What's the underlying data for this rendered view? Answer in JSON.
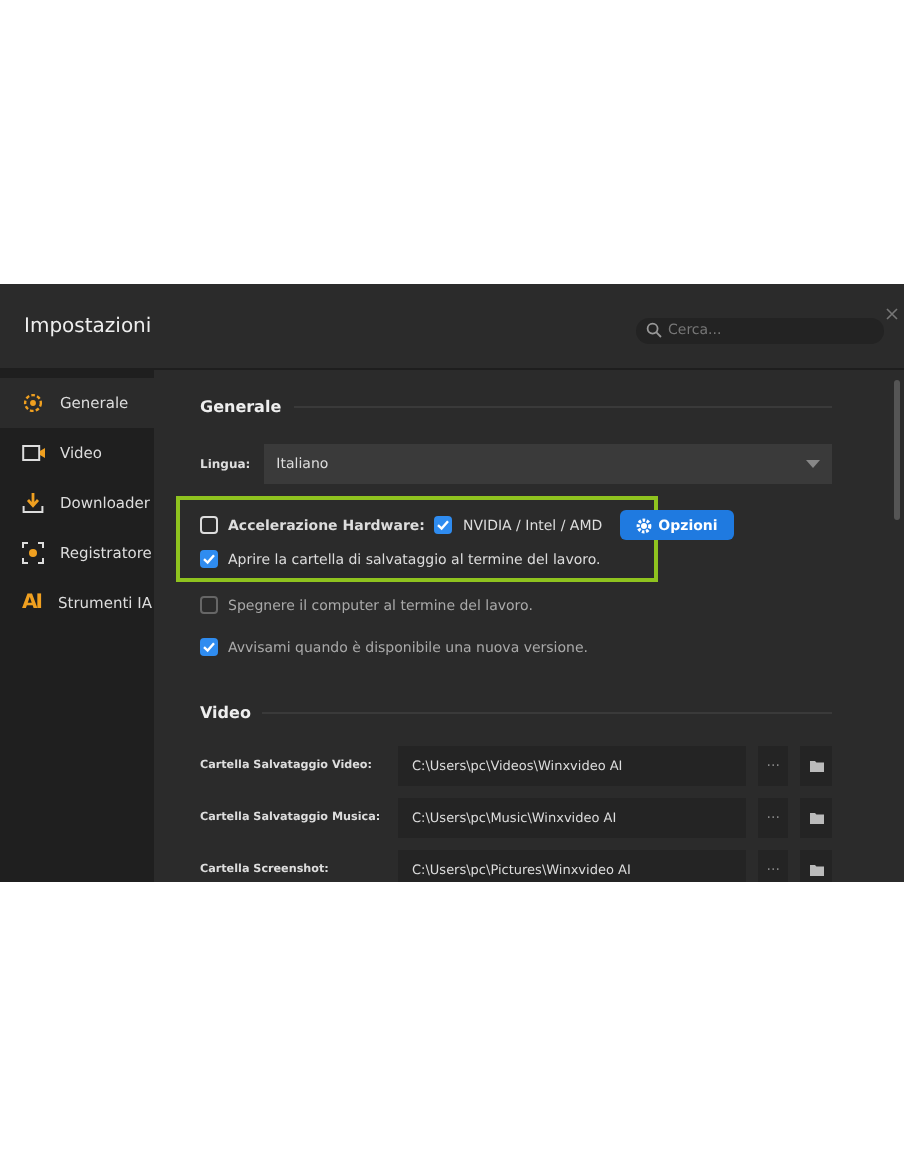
{
  "window": {
    "title": "Impostazioni"
  },
  "search": {
    "placeholder": "Cerca..."
  },
  "sidebar": {
    "items": [
      {
        "kind": "gear",
        "label": "Generale",
        "selected": true
      },
      {
        "kind": "video",
        "label": "Video",
        "selected": false
      },
      {
        "kind": "download",
        "label": "Downloader",
        "selected": false
      },
      {
        "kind": "record",
        "label": "Registratore",
        "selected": false
      },
      {
        "kind": "ai",
        "icon_text": "AI",
        "label": "Strumenti IA",
        "selected": false
      }
    ]
  },
  "general": {
    "heading": "Generale",
    "language": {
      "label": "Lingua:",
      "value": "Italiano"
    },
    "hardware": {
      "label": "Accelerazione Hardware:",
      "checked": false,
      "gpu_label": "NVIDIA / Intel / AMD",
      "gpu_checked": true,
      "button": "Opzioni"
    },
    "options": [
      {
        "label": "Aprire la cartella di salvataggio al termine del lavoro.",
        "checked": true,
        "highlighted": true
      },
      {
        "label": "Spegnere il computer al termine del lavoro.",
        "checked": false,
        "highlighted": false
      },
      {
        "label": "Avvisami quando è disponibile una nuova versione.",
        "checked": true,
        "highlighted": false
      }
    ]
  },
  "video": {
    "heading": "Video",
    "folders": [
      {
        "label": "Cartella Salvataggio Video:",
        "path": "C:\\Users\\pc\\Videos\\Winxvideo AI",
        "more": "···"
      },
      {
        "label": "Cartella Salvataggio Musica:",
        "path": "C:\\Users\\pc\\Music\\Winxvideo AI",
        "more": "···"
      },
      {
        "label": "Cartella Screenshot:",
        "path": "C:\\Users\\pc\\Pictures\\Winxvideo AI",
        "more": "···"
      }
    ]
  }
}
